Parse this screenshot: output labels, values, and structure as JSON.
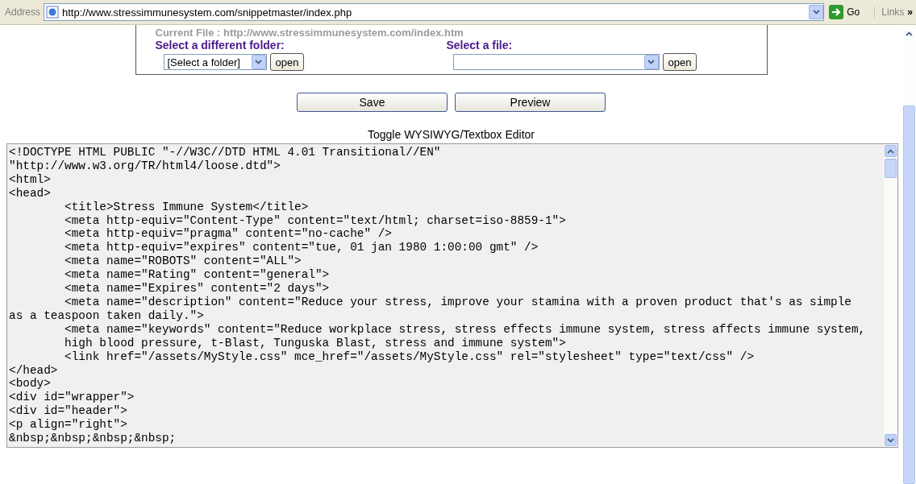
{
  "address_bar": {
    "label": "Address",
    "url": "http://www.stressimmunesystem.com/snippetmaster/index.php",
    "go": "Go",
    "links": "Links",
    "more": "»"
  },
  "file_panel": {
    "current_file": "Current File : http://www.stressimmunesystem.com/index.htm",
    "folder": {
      "label": "Select a different folder:",
      "value": "[Select a folder]",
      "button": "open"
    },
    "file": {
      "label": "Select a file:",
      "button": "open"
    }
  },
  "buttons": [
    "Save",
    "Preview"
  ],
  "toggle": "Toggle WYSIWYG/Textbox Editor",
  "editor_lines": [
    "<!DOCTYPE HTML PUBLIC \"-//W3C//DTD HTML 4.01 Transitional//EN\"",
    "\"http://www.w3.org/TR/html4/loose.dtd\">",
    "<html>",
    "<head>",
    "\t<title>Stress Immune System</title>",
    "\t<meta http-equiv=\"Content-Type\" content=\"text/html; charset=iso-8859-1\">",
    "\t<meta http-equiv=\"pragma\" content=\"no-cache\" />",
    "\t<meta http-equiv=\"expires\" content=\"tue, 01 jan 1980 1:00:00 gmt\" />",
    "\t<meta name=\"ROBOTS\" content=\"ALL\">",
    "\t<meta name=\"Rating\" content=\"general\">",
    "\t<meta name=\"Expires\" content=\"2 days\">",
    "\t<meta name=\"description\" content=\"Reduce your stress, improve your stamina with a proven product that's as simple",
    "as a teaspoon taken daily.\">",
    "\t<meta name=\"keywords\" content=\"Reduce workplace stress, stress effects immune system, stress affects immune system,",
    "\thigh blood pressure, t-Blast, Tunguska Blast, stress and immune system\">",
    "\t<link href=\"/assets/MyStyle.css\" mce_href=\"/assets/MyStyle.css\" rel=\"stylesheet\" type=\"text/css\" />",
    "</head>",
    "<body>",
    "<div id=\"wrapper\">",
    "<div id=\"header\">",
    "<p align=\"right\">",
    "&nbsp;&nbsp;&nbsp;&nbsp;"
  ]
}
